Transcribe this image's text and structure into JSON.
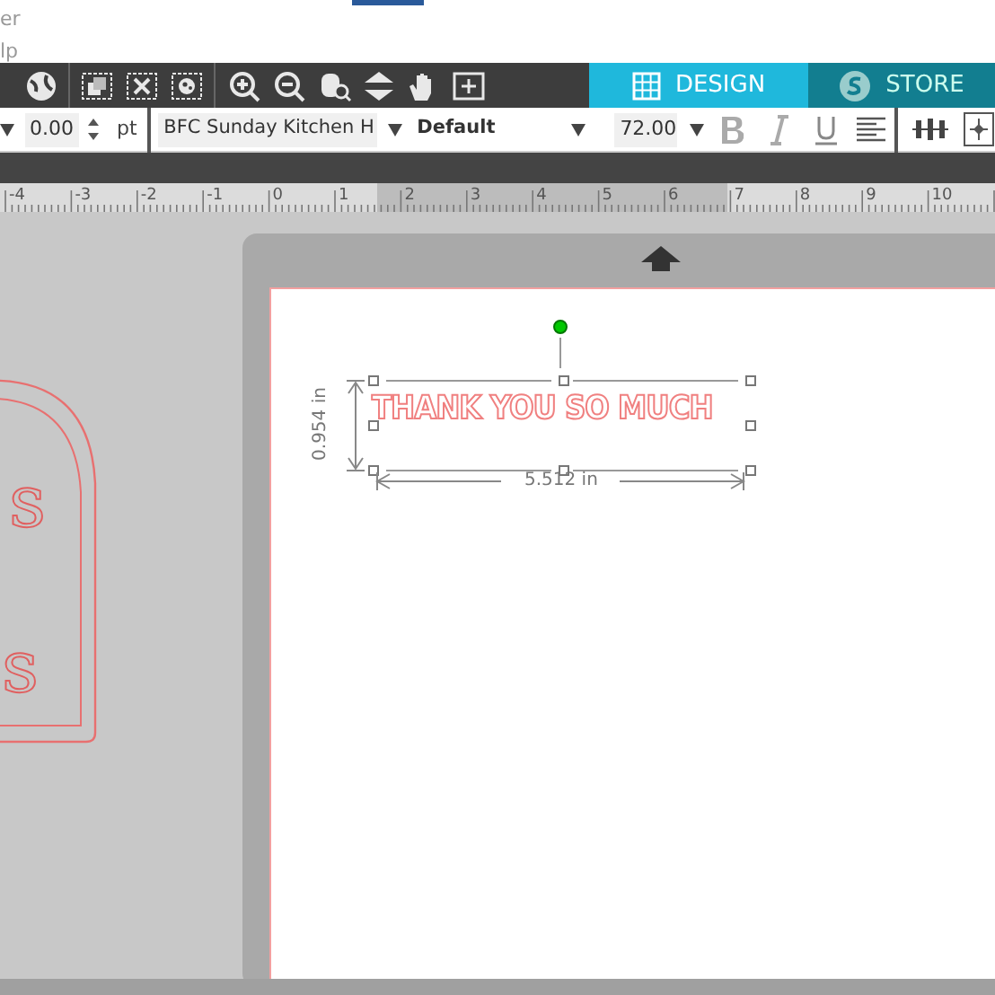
{
  "menu": {
    "items": [
      "er",
      "lp"
    ]
  },
  "tabs": [
    {
      "label": "DESIGN",
      "selected": true
    },
    {
      "label": "STORE",
      "selected": false
    }
  ],
  "text_properties": {
    "spacing": "0.00",
    "unit": "pt",
    "font": "BFC Sunday Kitchen H",
    "style": "Default",
    "size": "72.00"
  },
  "ruler": {
    "labels": [
      "-4",
      "-3",
      "-2",
      "-1",
      "0",
      "1",
      "2",
      "3",
      "4",
      "5",
      "6",
      "7",
      "8",
      "9",
      "10"
    ]
  },
  "canvas": {
    "side_design_texts": [
      "s",
      "s"
    ],
    "selection": {
      "text": "THANK YOU SO MUCH",
      "height": "0.954 in",
      "width": "5.512 in"
    }
  }
}
